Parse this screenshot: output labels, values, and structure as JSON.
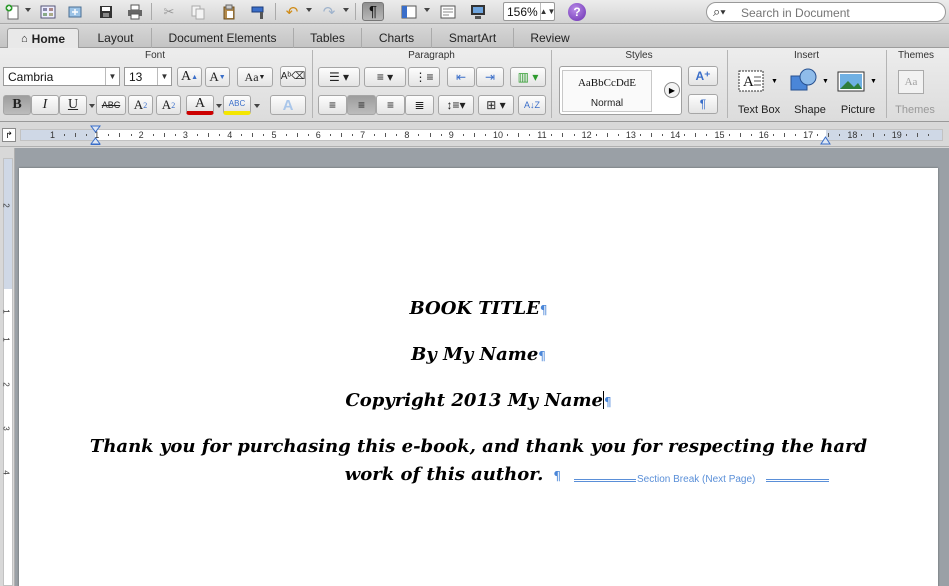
{
  "toolbar": {
    "zoom": "156%",
    "help_glyph": "?",
    "search_placeholder": "Search in Document",
    "icons": [
      "new-document-icon",
      "templates-icon",
      "open-icon",
      "save-icon",
      "print-icon",
      "cut-icon",
      "copy-icon",
      "paste-icon",
      "format-painter-icon",
      "undo-icon",
      "redo-icon",
      "show-formatting-icon",
      "sidebar-icon",
      "gallery-icon",
      "media-browser-icon"
    ]
  },
  "tabs": [
    {
      "label": "Home",
      "active": true
    },
    {
      "label": "Layout"
    },
    {
      "label": "Document Elements"
    },
    {
      "label": "Tables"
    },
    {
      "label": "Charts"
    },
    {
      "label": "SmartArt"
    },
    {
      "label": "Review"
    }
  ],
  "ribbon": {
    "groups": {
      "font": "Font",
      "paragraph": "Paragraph",
      "styles": "Styles",
      "insert": "Insert",
      "themes": "Themes"
    },
    "font_name": "Cambria",
    "font_size": "13",
    "grow_font": "A",
    "shrink_font": "A",
    "change_case": "Aa",
    "bold": "B",
    "italic": "I",
    "underline": "U",
    "strikethrough": "ABC",
    "superscript": "A",
    "superscript_mark": "2",
    "subscript": "A",
    "subscript_mark": "2",
    "font_color": "A",
    "highlight": "ABC",
    "text_effects": "A",
    "style_sample": "AaBbCcDdE",
    "style_name": "Normal",
    "insert_items": [
      "Text Box",
      "Shape",
      "Picture"
    ],
    "themes_preview": "Aa",
    "themes_label": "Themes",
    "accent_color": "#4a86d8"
  },
  "ruler": {
    "numbers": [
      "1",
      "1",
      "2",
      "3",
      "4",
      "5",
      "6",
      "7",
      "8",
      "9",
      "10",
      "11",
      "12",
      "13",
      "14",
      "15",
      "16",
      "17",
      "18",
      "19"
    ],
    "vertical_numbers": [
      "2",
      "1",
      "1",
      "2",
      "3",
      "4"
    ]
  },
  "document": {
    "lines": [
      "BOOK TITLE",
      "By My Name",
      "Copyright 2013 My Name",
      "Thank you for purchasing this e-book, and thank you for respecting the hard",
      "work of this author."
    ],
    "pilcrow": "¶",
    "section_break_label": "Section Break (Next Page)"
  }
}
